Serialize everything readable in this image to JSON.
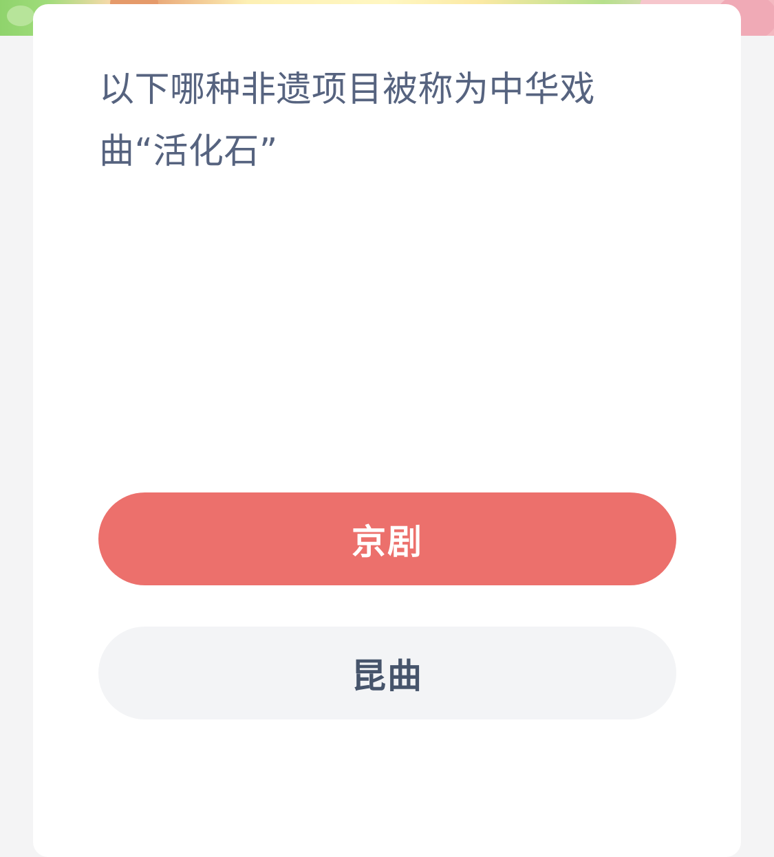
{
  "question": {
    "text": "以下哪种非遗项目被称为中华戏曲“活化石”"
  },
  "options": [
    {
      "label": "京剧",
      "state": "selected"
    },
    {
      "label": "昆曲",
      "state": "normal"
    }
  ],
  "colors": {
    "page_background": "#f4f4f5",
    "card_background": "#ffffff",
    "question_text": "#56637f",
    "selected_option_background": "#ec706c",
    "selected_option_text": "#ffffff",
    "option_background": "#f3f4f6",
    "option_text": "#46546b"
  }
}
